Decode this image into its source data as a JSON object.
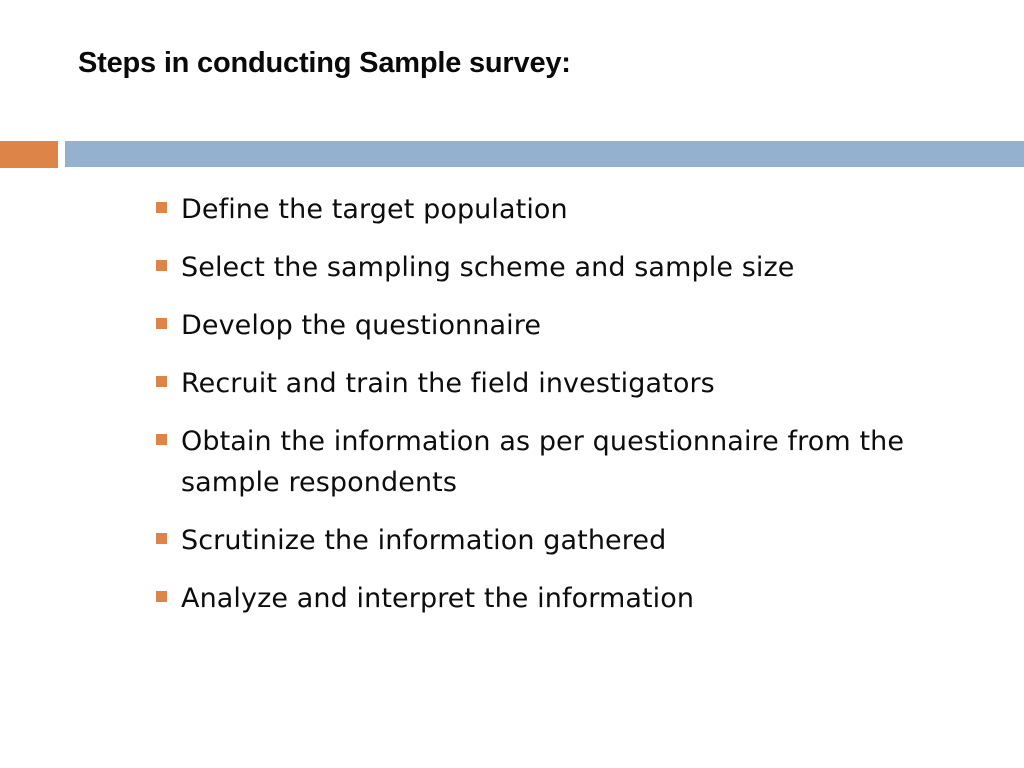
{
  "slide": {
    "title": "Steps in conducting Sample survey:",
    "background_color": "#ffffff",
    "text_color": "#0d0d0d"
  },
  "divider": {
    "accent_color": "#dd8549",
    "bar_color": "#94b2d0"
  },
  "bullets": {
    "marker_color": "#dd8549",
    "items": [
      {
        "text": "Define the target population"
      },
      {
        "text": "Select the sampling scheme and sample size"
      },
      {
        "text": "Develop the questionnaire"
      },
      {
        "text": "Recruit and train the field investigators"
      },
      {
        "text": "Obtain the information as per questionnaire from the sample respondents"
      },
      {
        "text": "Scrutinize the information gathered"
      },
      {
        "text": "Analyze and interpret the information"
      }
    ]
  }
}
